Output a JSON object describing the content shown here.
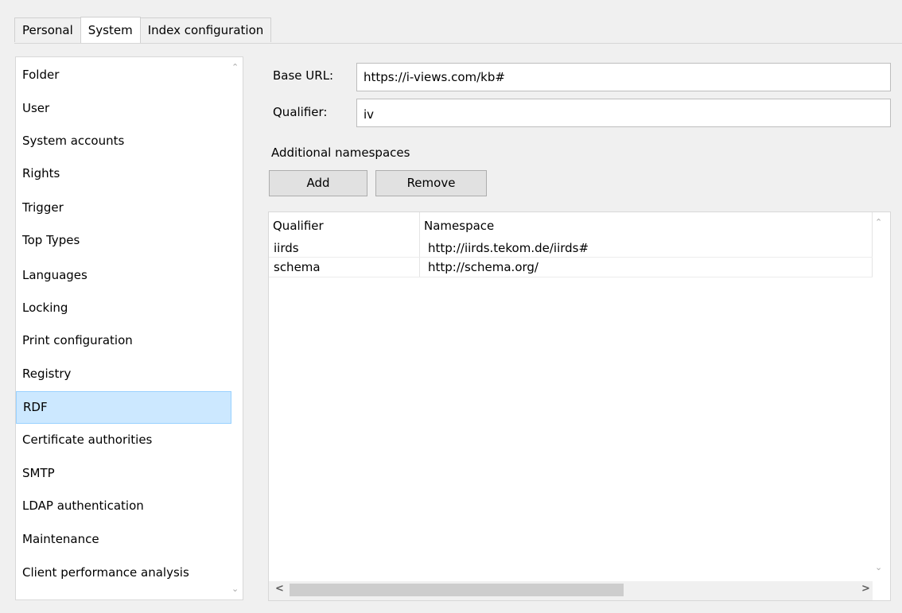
{
  "tabs": [
    "Personal",
    "System",
    "Index configuration"
  ],
  "nav_items": [
    "Folder",
    "User",
    "System accounts",
    "Rights",
    "Trigger",
    "Top Types",
    "Languages",
    "Locking",
    "Print configuration",
    "Registry",
    "RDF",
    "Certificate authorities",
    "SMTP",
    "LDAP authentication",
    "Maintenance",
    "Client performance analysis"
  ],
  "selected_item": "RDF",
  "form": {
    "base_url_label": "Base URL:",
    "base_url_value": "https://i-views.com/kb#",
    "qualifier_label": "Qualifier:",
    "qualifier_value": "iv",
    "namespaces_label": "Additional namespaces",
    "add_label": "Add",
    "remove_label": "Remove"
  },
  "table": {
    "columns": [
      "Qualifier",
      "Namespace"
    ],
    "rows": [
      [
        "iirds",
        "http://iirds.tekom.de/iirds#"
      ],
      [
        "schema",
        "http://schema.org/"
      ]
    ]
  },
  "colors": {
    "selection_bg": "#cce8ff",
    "selection_border": "#99d1ff",
    "button_bg": "#e1e1e1"
  }
}
